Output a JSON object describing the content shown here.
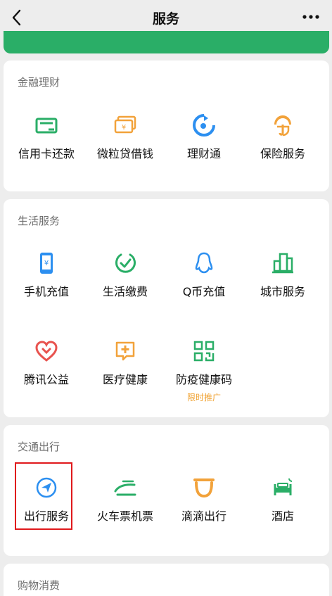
{
  "header": {
    "title": "服务",
    "back_icon": "chevron-left-icon",
    "more_icon": "more-dots-icon"
  },
  "sections": {
    "finance": {
      "title": "金融理财",
      "items": [
        {
          "label": "信用卡还款",
          "icon": "credit-card-icon",
          "color": "#2aae67"
        },
        {
          "label": "微粒贷借钱",
          "icon": "loan-card-icon",
          "color": "#f2a23a"
        },
        {
          "label": "理财通",
          "icon": "wealth-icon",
          "color": "#2c8ff0"
        },
        {
          "label": "保险服务",
          "icon": "insurance-icon",
          "color": "#f2a23a"
        }
      ]
    },
    "life": {
      "title": "生活服务",
      "items": [
        {
          "label": "手机充值",
          "icon": "phone-topup-icon",
          "color": "#2c8ff0"
        },
        {
          "label": "生活缴费",
          "icon": "utility-bill-icon",
          "color": "#2aae67"
        },
        {
          "label": "Q币充值",
          "icon": "qq-penguin-icon",
          "color": "#2c8ff0"
        },
        {
          "label": "城市服务",
          "icon": "city-buildings-icon",
          "color": "#2aae67"
        },
        {
          "label": "腾讯公益",
          "icon": "charity-heart-icon",
          "color": "#e8534f"
        },
        {
          "label": "医疗健康",
          "icon": "medical-icon",
          "color": "#f2a23a"
        },
        {
          "label": "防疫健康码",
          "icon": "qr-code-icon",
          "color": "#2aae67",
          "sub": "限时推广"
        }
      ]
    },
    "transport": {
      "title": "交通出行",
      "items": [
        {
          "label": "出行服务",
          "icon": "navigation-arrow-icon",
          "color": "#2c8ff0"
        },
        {
          "label": "火车票机票",
          "icon": "train-ticket-icon",
          "color": "#2aae67"
        },
        {
          "label": "滴滴出行",
          "icon": "didi-icon",
          "color": "#f2a23a"
        },
        {
          "label": "酒店",
          "icon": "hotel-bed-icon",
          "color": "#2aae67"
        }
      ]
    },
    "shopping": {
      "title": "购物消费"
    }
  }
}
